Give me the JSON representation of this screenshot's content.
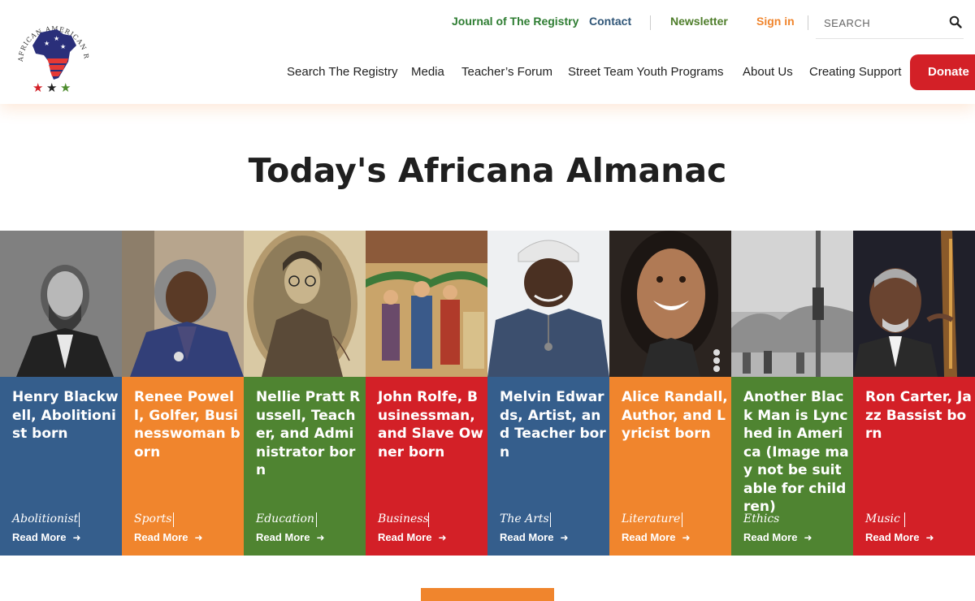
{
  "header": {
    "logo_text": "AFRICAN AMERICAN REGISTRY",
    "utility_links": {
      "journal": "Journal of The Registry",
      "contact": "Contact",
      "newsletter": "Newsletter",
      "sign_in": "Sign in"
    },
    "search": {
      "placeholder": "SEARCH"
    },
    "nav": {
      "search_registry": "Search The Registry",
      "media": "Media",
      "teachers_forum": "Teacher’s Forum",
      "street_team": "Street Team Youth Programs",
      "about_us": "About Us",
      "creating_support": "Creating Support",
      "donate": "Donate"
    }
  },
  "main": {
    "title": "Today's Africana Almanac",
    "cards": [
      {
        "title": "Henry Blackwell, Abolitionist born",
        "category": "Abolitionist",
        "read_more": "Read More",
        "color": "#355e8c"
      },
      {
        "title": "Renee Powell, Golfer, Businesswoman born",
        "category": "Sports",
        "read_more": "Read More",
        "color": "#f0852d"
      },
      {
        "title": "Nellie Pratt Russell, Teacher, and Administrator born",
        "category": "Education",
        "read_more": "Read More",
        "color": "#4f8431"
      },
      {
        "title": "John Rolfe, Businessman, and Slave Owner born",
        "category": "Business",
        "read_more": "Read More",
        "color": "#d32027"
      },
      {
        "title": "Melvin Edwards, Artist, and Teacher born",
        "category": "The Arts",
        "read_more": "Read More",
        "color": "#355e8c"
      },
      {
        "title": "Alice Randall, Author, and Lyricist born",
        "category": "Literature",
        "read_more": "Read More",
        "color": "#f0852d"
      },
      {
        "title": "Another Black Man is Lynched in America (Image may not be suitable for children)",
        "category": "Ethics",
        "read_more": "Read More",
        "color": "#4f8431"
      },
      {
        "title": "Ron Carter, Jazz Bassist born",
        "category": "Music",
        "read_more": "Read More",
        "color": "#d32027"
      }
    ]
  },
  "colors": {
    "brand_red": "#d32027",
    "brand_orange": "#f0852d",
    "brand_green": "#4f8431",
    "brand_blue": "#355e8c"
  }
}
